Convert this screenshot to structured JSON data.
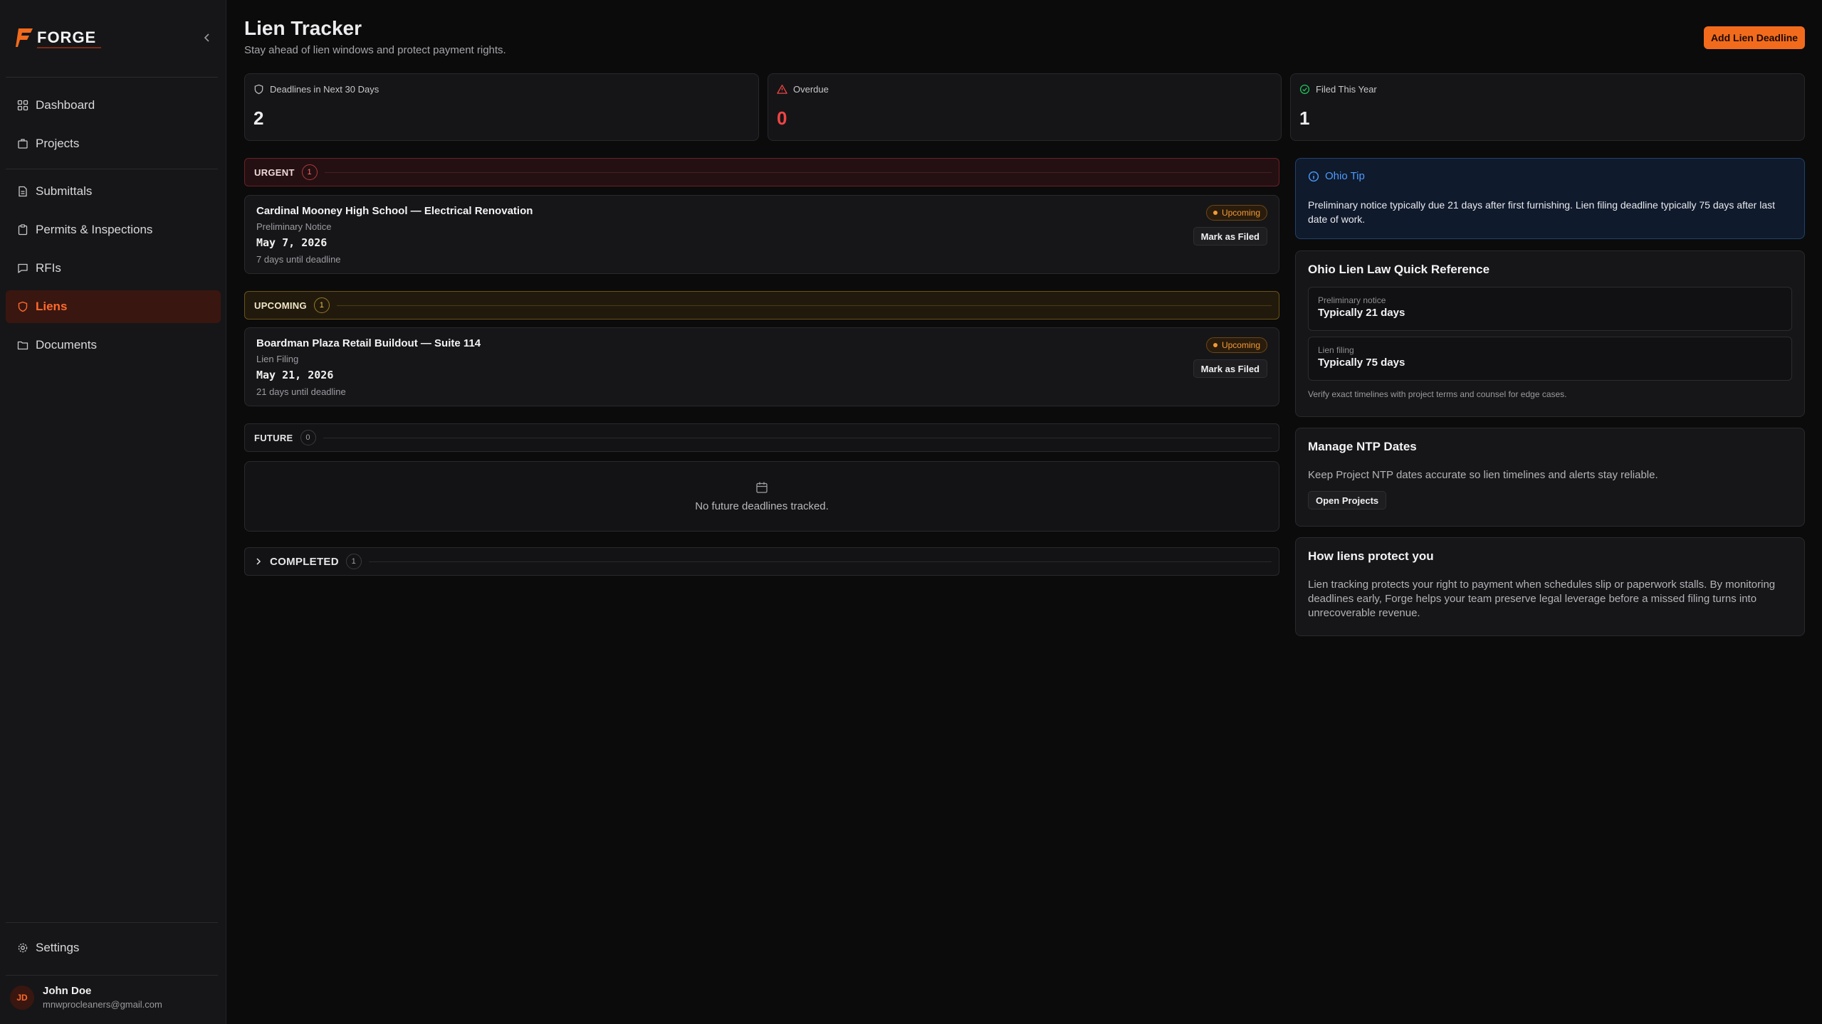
{
  "app": {
    "brand": "FORGE",
    "accent": "#f26b1d"
  },
  "sidebar": {
    "items": [
      {
        "label": "Dashboard",
        "icon": "grid-icon"
      },
      {
        "label": "Projects",
        "icon": "building-icon"
      },
      {
        "label": "Submittals",
        "icon": "file-icon"
      },
      {
        "label": "Permits & Inspections",
        "icon": "clipboard-icon"
      },
      {
        "label": "RFIs",
        "icon": "message-icon"
      },
      {
        "label": "Liens",
        "icon": "shield-icon",
        "active": true
      },
      {
        "label": "Documents",
        "icon": "folder-icon"
      }
    ],
    "settings_label": "Settings",
    "user": {
      "initials": "JD",
      "name": "John Doe",
      "email": "mnwprocleaners@gmail.com"
    }
  },
  "header": {
    "title": "Lien Tracker",
    "subtitle": "Stay ahead of lien windows and protect payment rights.",
    "add_button": "Add Lien Deadline"
  },
  "stats": [
    {
      "label": "Deadlines in Next 30 Days",
      "value": "2",
      "icon": "shield-icon",
      "color": "#ececee"
    },
    {
      "label": "Overdue",
      "value": "0",
      "icon": "alert-triangle-icon",
      "color": "#ef4444"
    },
    {
      "label": "Filed This Year",
      "value": "1",
      "icon": "check-circle-icon",
      "color": "#ececee"
    }
  ],
  "sections": {
    "urgent": {
      "label": "URGENT",
      "count": "1"
    },
    "upcoming": {
      "label": "UPCOMING",
      "count": "1"
    },
    "future": {
      "label": "FUTURE",
      "count": "0",
      "empty_text": "No future deadlines tracked."
    },
    "completed": {
      "label": "COMPLETED",
      "count": "1"
    }
  },
  "liens": [
    {
      "project": "Cardinal Mooney High School — Electrical Renovation",
      "type": "Preliminary Notice",
      "date": "May 7, 2026",
      "days_left": "7 days until deadline",
      "status": "Upcoming",
      "action": "Mark as Filed"
    },
    {
      "project": "Boardman Plaza Retail Buildout — Suite 114",
      "type": "Lien Filing",
      "date": "May 21, 2026",
      "days_left": "21 days until deadline",
      "status": "Upcoming",
      "action": "Mark as Filed"
    }
  ],
  "tip": {
    "title": "Ohio Tip",
    "body": "Preliminary notice typically due 21 days after first furnishing. Lien filing deadline typically 75 days after last date of work."
  },
  "reference": {
    "title": "Ohio Lien Law Quick Reference",
    "items": [
      {
        "label": "Preliminary notice",
        "value": "Typically 21 days"
      },
      {
        "label": "Lien filing",
        "value": "Typically 75 days"
      }
    ],
    "note": "Verify exact timelines with project terms and counsel for edge cases."
  },
  "ntp": {
    "title": "Manage NTP Dates",
    "body": "Keep Project NTP dates accurate so lien timelines and alerts stay reliable.",
    "button": "Open Projects"
  },
  "protect": {
    "title": "How liens protect you",
    "body": "Lien tracking protects your right to payment when schedules slip or paperwork stalls. By monitoring deadlines early, Forge helps your team preserve legal leverage before a missed filing turns into unrecoverable revenue."
  }
}
